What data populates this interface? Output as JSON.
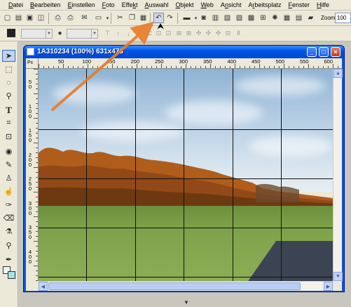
{
  "menubar": {
    "items": [
      {
        "label": "Datei",
        "underline": "D"
      },
      {
        "label": "Bearbeiten",
        "underline": "B"
      },
      {
        "label": "Einstellen",
        "underline": "E"
      },
      {
        "label": "Foto",
        "underline": "F"
      },
      {
        "label": "Effekt",
        "underline": "k"
      },
      {
        "label": "Auswahl",
        "underline": "A"
      },
      {
        "label": "Objekt",
        "underline": "O"
      },
      {
        "label": "Web",
        "underline": "W"
      },
      {
        "label": "Ansicht",
        "underline": "n"
      },
      {
        "label": "Arbeitsplatz",
        "underline": "r"
      },
      {
        "label": "Fenster",
        "underline": "F"
      },
      {
        "label": "Hilfe",
        "underline": "H"
      }
    ]
  },
  "toolbar": {
    "zoom_label": "Zoom",
    "zoom_value": "100",
    "icons": [
      "new-file-icon",
      "open-file-icon",
      "save-icon",
      "save-web-icon",
      "print-icon",
      "print-preview-icon",
      "email-icon",
      "scan-icon",
      "cut-icon",
      "copy-icon",
      "paste-icon",
      "undo-icon",
      "redo-icon",
      "photo-icon",
      "camera-icon",
      "film-icon",
      "image-icon",
      "panorama-icon",
      "monitor-icon",
      "fit-icon",
      "light-icon",
      "frame-icon",
      "image-list-icon"
    ]
  },
  "document": {
    "title": "1A310234 (100%) 631x473",
    "ruler_unit": "Px",
    "h_ticks": [
      "50",
      "100",
      "150",
      "200",
      "250",
      "300",
      "350",
      "400",
      "450",
      "500",
      "550",
      "600"
    ],
    "v_ticks": [
      "5\n0",
      "1\n0\n0",
      "1\n5\n0",
      "2\n0\n0",
      "2\n5\n0",
      "3\n0\n0",
      "3\n5\n0",
      "4\n0\n0"
    ]
  },
  "colors": {
    "titlebar": "#0055e5",
    "annotation_arrow": "#e87d2c",
    "foreground_swatch": "#e8f8f8",
    "background_swatch": "#9fe7e6"
  }
}
